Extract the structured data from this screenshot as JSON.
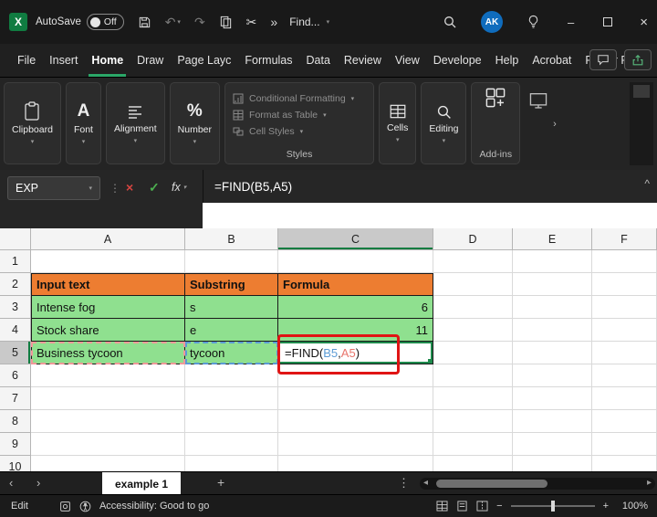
{
  "titlebar": {
    "autosave_label": "AutoSave",
    "autosave_state": "Off",
    "find_label": "Find...",
    "avatar_initials": "AK"
  },
  "menubar": {
    "items": [
      {
        "label": "File"
      },
      {
        "label": "Insert"
      },
      {
        "label": "Home"
      },
      {
        "label": "Draw"
      },
      {
        "label": "Page Layc"
      },
      {
        "label": "Formulas"
      },
      {
        "label": "Data"
      },
      {
        "label": "Review"
      },
      {
        "label": "View"
      },
      {
        "label": "Develope"
      },
      {
        "label": "Help"
      },
      {
        "label": "Acrobat"
      },
      {
        "label": "Power Piv"
      }
    ],
    "active_item": "Home"
  },
  "ribbon": {
    "groups": {
      "clipboard": "Clipboard",
      "font": "Font",
      "alignment": "Alignment",
      "number": "Number",
      "cells": "Cells",
      "editing": "Editing"
    },
    "styles": {
      "buttons": [
        {
          "label": "Conditional Formatting"
        },
        {
          "label": "Format as Table"
        },
        {
          "label": "Cell Styles"
        }
      ],
      "group_label": "Styles"
    },
    "addins_group_label": "Add-ins"
  },
  "formula_bar": {
    "name_box_value": "EXP",
    "fx_label": "fx",
    "formula": "=FIND(B5,A5)"
  },
  "grid": {
    "column_headers": [
      "A",
      "B",
      "C",
      "D",
      "E",
      "F"
    ],
    "row_headers": [
      "1",
      "2",
      "3",
      "4",
      "5",
      "6",
      "7",
      "8",
      "9",
      "10"
    ],
    "selected_column": "C",
    "selected_row": "5",
    "table": {
      "header": {
        "input": "Input text",
        "substring": "Substring",
        "formula": "Formula"
      },
      "row3": {
        "a": "Intense fog",
        "b": "s",
        "c": "6"
      },
      "row4": {
        "a": "Stock share",
        "b": "e",
        "c": "11"
      },
      "row5": {
        "a": "Business tycoon",
        "b": "tycoon"
      }
    },
    "c5_formula": {
      "prefix": "=FIND(",
      "ref1": "B5",
      "comma": ",",
      "ref2": "A5",
      "suffix": ")"
    }
  },
  "sheet_tabs": {
    "active_tab": "example 1"
  },
  "status_bar": {
    "mode": "Edit",
    "accessibility_text": "Accessibility: Good to go",
    "zoom_level": "100%"
  },
  "icons": {
    "excel_logo": "X",
    "undo": "↶",
    "redo": "↷",
    "scissors": "✂",
    "chevrons_right": "»",
    "chevron_down": "▾",
    "minimize": "–",
    "close": "×",
    "cancel": "×",
    "enter": "✓",
    "caret_collapse": "^",
    "dots_vertical": "⋮",
    "tab_prev": "‹",
    "tab_next": "›",
    "add_sheet": "+",
    "scroll_left": "◂",
    "scroll_right": "▸",
    "font_a": "A",
    "percent": "%",
    "zoom_out": "−",
    "zoom_in": "+"
  },
  "colors": {
    "accent_green": "#107C41",
    "header_orange": "#ED7D31",
    "cell_green": "#8FE08F",
    "ref_blue": "#5B9BD5",
    "ref_red": "#E8756C",
    "annotation_red": "#E01414"
  }
}
